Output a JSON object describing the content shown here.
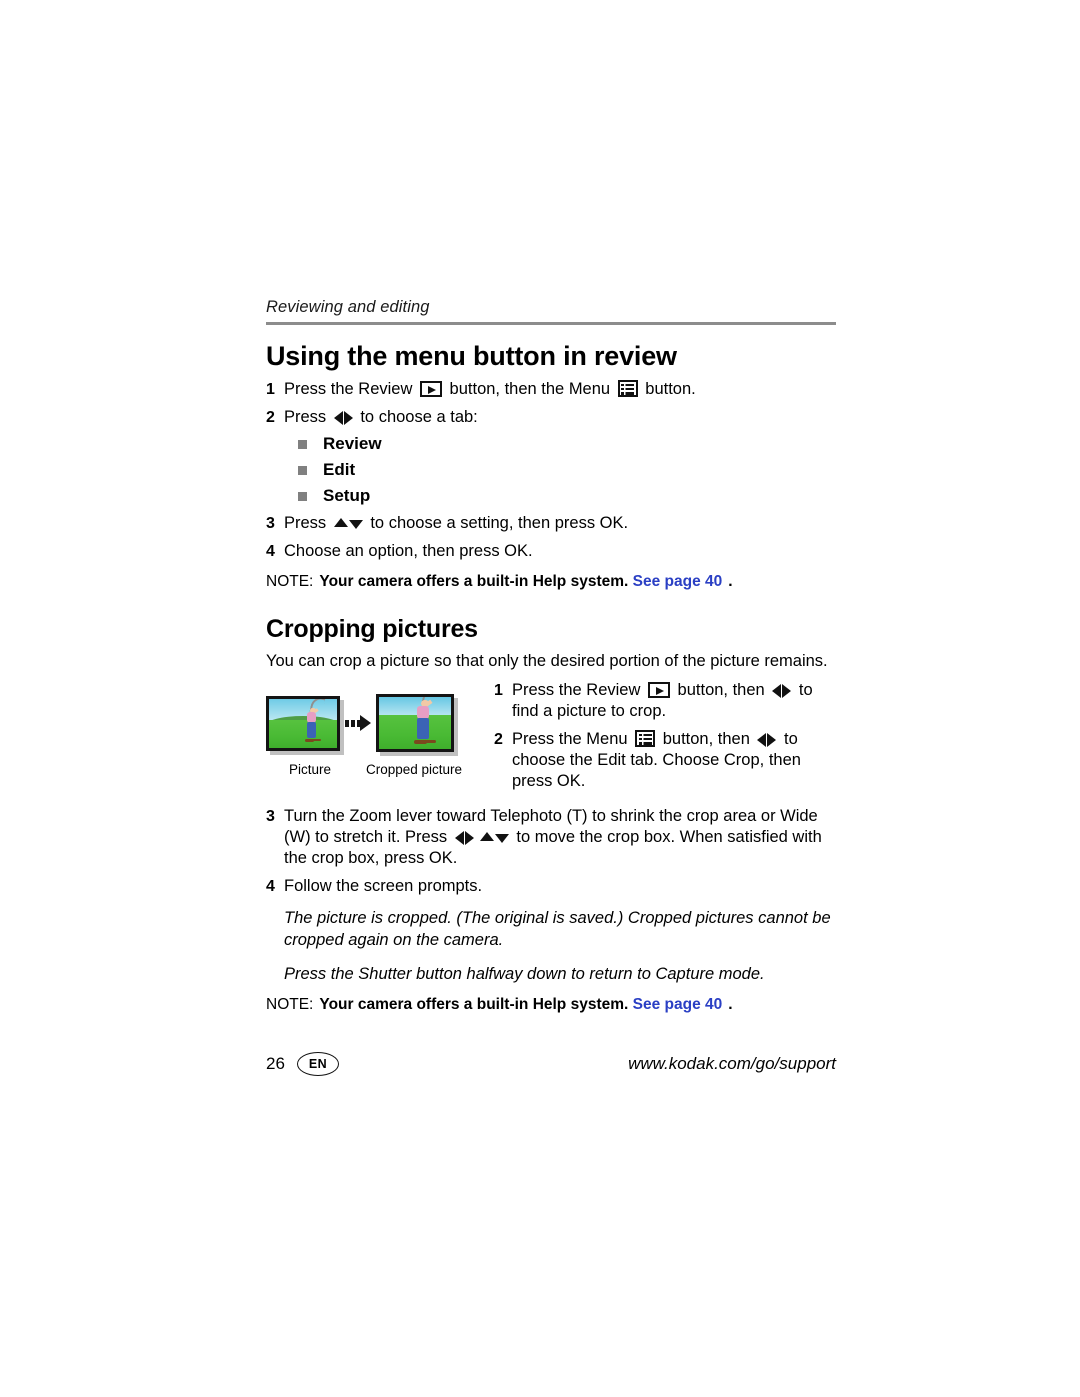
{
  "document": {
    "running_header": "Reviewing and editing",
    "page_number": "26",
    "language_badge": "EN",
    "support_url": "www.kodak.com/go/support"
  },
  "section_menu": {
    "title": "Using the menu button in review",
    "steps": [
      {
        "num": "1",
        "parts": [
          {
            "type": "text",
            "value": "Press the Review "
          },
          {
            "type": "icon",
            "value": "review-button-icon"
          },
          {
            "type": "text",
            "value": " button, then the Menu "
          },
          {
            "type": "icon",
            "value": "menu-button-icon"
          },
          {
            "type": "text",
            "value": " button."
          }
        ],
        "plain": "Press the Review button, then the Menu button."
      },
      {
        "num": "2",
        "plain": "Press to choose a tab:",
        "text_before": "Press ",
        "text_after": " to choose a tab:"
      },
      {
        "num": "3",
        "plain": "Press to choose a setting, then press OK.",
        "text_before": "Press ",
        "text_after": " to choose a setting, then press OK."
      },
      {
        "num": "4",
        "plain": "Choose an option, then press OK."
      }
    ],
    "tabs": [
      {
        "label": "Review"
      },
      {
        "label": "Edit"
      },
      {
        "label": "Setup"
      }
    ],
    "note": {
      "keyword": "NOTE:",
      "body": "Your camera offers a built-in Help system.",
      "link": "See page 40",
      "trailing": "."
    }
  },
  "section_crop": {
    "title": "Cropping pictures",
    "intro": "You can crop a picture so that only the desired portion of the picture remains.",
    "figure": {
      "caption_original": "Picture",
      "caption_cropped": "Cropped picture",
      "arrow": "right-arrow-icon"
    },
    "steps": [
      {
        "num": "1",
        "text_a": "Press the Review ",
        "text_b": " button, then ",
        "text_c": " to find a picture to crop.",
        "plain": "Press the Review button, then to find a picture to crop."
      },
      {
        "num": "2",
        "text_a": "Press the Menu ",
        "text_b": " button, then ",
        "text_c": " to choose the Edit tab. Choose Crop, then press OK.",
        "plain": "Press the Menu button, then to choose the Edit tab. Choose Crop, then press OK."
      },
      {
        "num": "3",
        "text_a": "Turn the Zoom lever toward Telephoto (T) to shrink the crop area or Wide (W) to stretch it. Press ",
        "text_b": " to move the crop box. When satisfied with the crop box, press OK.",
        "plain": "Turn the Zoom lever toward Telephoto (T) to shrink the crop area or Wide (W) to stretch it. Press to move the crop box. When satisfied with the crop box, press OK."
      },
      {
        "num": "4",
        "plain": "Follow the screen prompts."
      }
    ],
    "result_paragraph": "The picture is cropped. (The original is saved.) Cropped pictures cannot be cropped again on the camera.",
    "shutter_paragraph": "Press the Shutter button halfway down to return to Capture mode.",
    "note": {
      "keyword": "NOTE:",
      "body": "Your camera offers a built-in Help system.",
      "link": "See page 40",
      "trailing": "."
    }
  },
  "colors": {
    "link_blue": "#2a3fc4",
    "rule_gray": "#8c8c8c",
    "bullet_gray": "#808080",
    "text_black": "#000000"
  }
}
